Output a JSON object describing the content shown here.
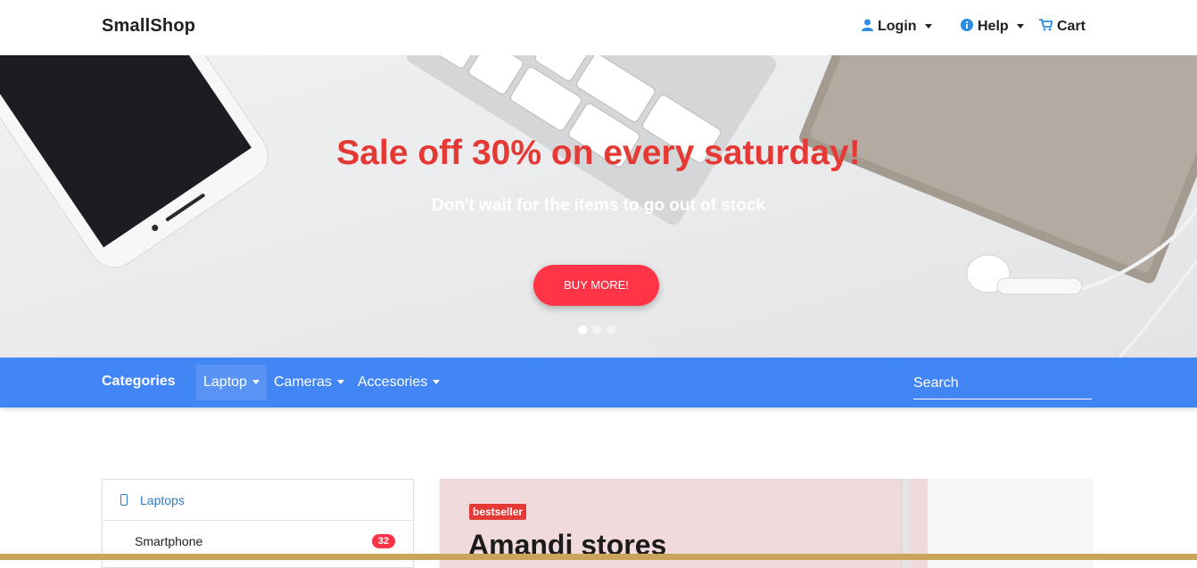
{
  "header": {
    "brand": "SmallShop",
    "login_label": "Login",
    "help_label": "Help",
    "cart_label": "Cart"
  },
  "hero": {
    "title": "Sale off 30% on every saturday!",
    "subtitle": "Don't wait for the items to go out of stock",
    "button_label": "BUY MORE!",
    "slides_count": 3,
    "active_slide": 1
  },
  "catbar": {
    "title": "Categories",
    "items": [
      {
        "label": "Laptop"
      },
      {
        "label": "Cameras"
      },
      {
        "label": "Accesories"
      }
    ],
    "search_placeholder": "Search"
  },
  "sidebar": {
    "header_label": "Laptops",
    "items": [
      {
        "label": "Smartphone",
        "count": "32"
      }
    ]
  },
  "promo": {
    "badge": "bestseller",
    "title": "Amandi stores"
  },
  "colors": {
    "accent_blue": "#4285f4",
    "hero_title": "#e53935",
    "button_red": "#ff3547",
    "link_blue": "#2f7bc3"
  },
  "icons": {
    "login": "user-icon",
    "help": "info-icon",
    "cart": "cart-icon",
    "laptops": "mobile-icon"
  }
}
